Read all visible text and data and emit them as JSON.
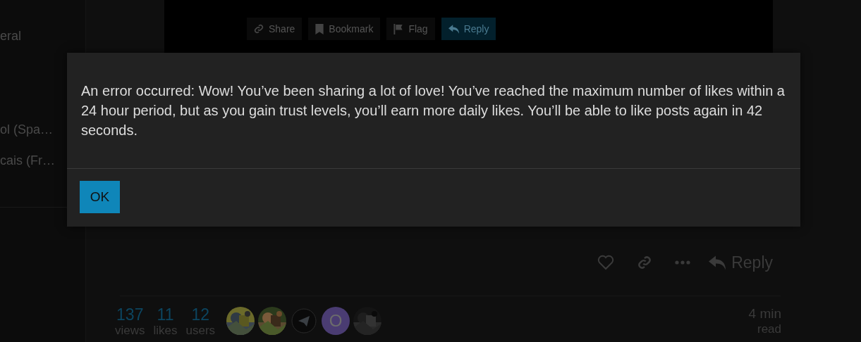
{
  "sidebar": {
    "items": [
      {
        "label": "eral"
      },
      {
        "label": "ol (Spa…"
      },
      {
        "label": "cais (Fr…"
      }
    ]
  },
  "post_buttons": [
    {
      "label": "Share",
      "primary": false
    },
    {
      "label": "Bookmark",
      "primary": false
    },
    {
      "label": "Flag",
      "primary": false
    },
    {
      "label": "Reply",
      "primary": true
    }
  ],
  "post_controls": {
    "reply": "Reply"
  },
  "stats": [
    {
      "value": "137",
      "label": "views"
    },
    {
      "value": "11",
      "label": "likes"
    },
    {
      "value": "12",
      "label": "users"
    }
  ],
  "avatars": [
    {
      "kind": "picture"
    },
    {
      "kind": "picture"
    },
    {
      "kind": "icon"
    },
    {
      "kind": "letter",
      "letter": "O"
    },
    {
      "kind": "picture"
    }
  ],
  "read_time": {
    "value": "4 min",
    "label": "read"
  },
  "dialog": {
    "message": "An error occurred: Wow! You’ve been sharing a lot of love! You’ve reached the maximum number of likes within a 24 hour period, but as you gain trust levels, you’ll earn more daily likes. You’ll be able to like posts again in 42 seconds.",
    "button": "OK"
  }
}
